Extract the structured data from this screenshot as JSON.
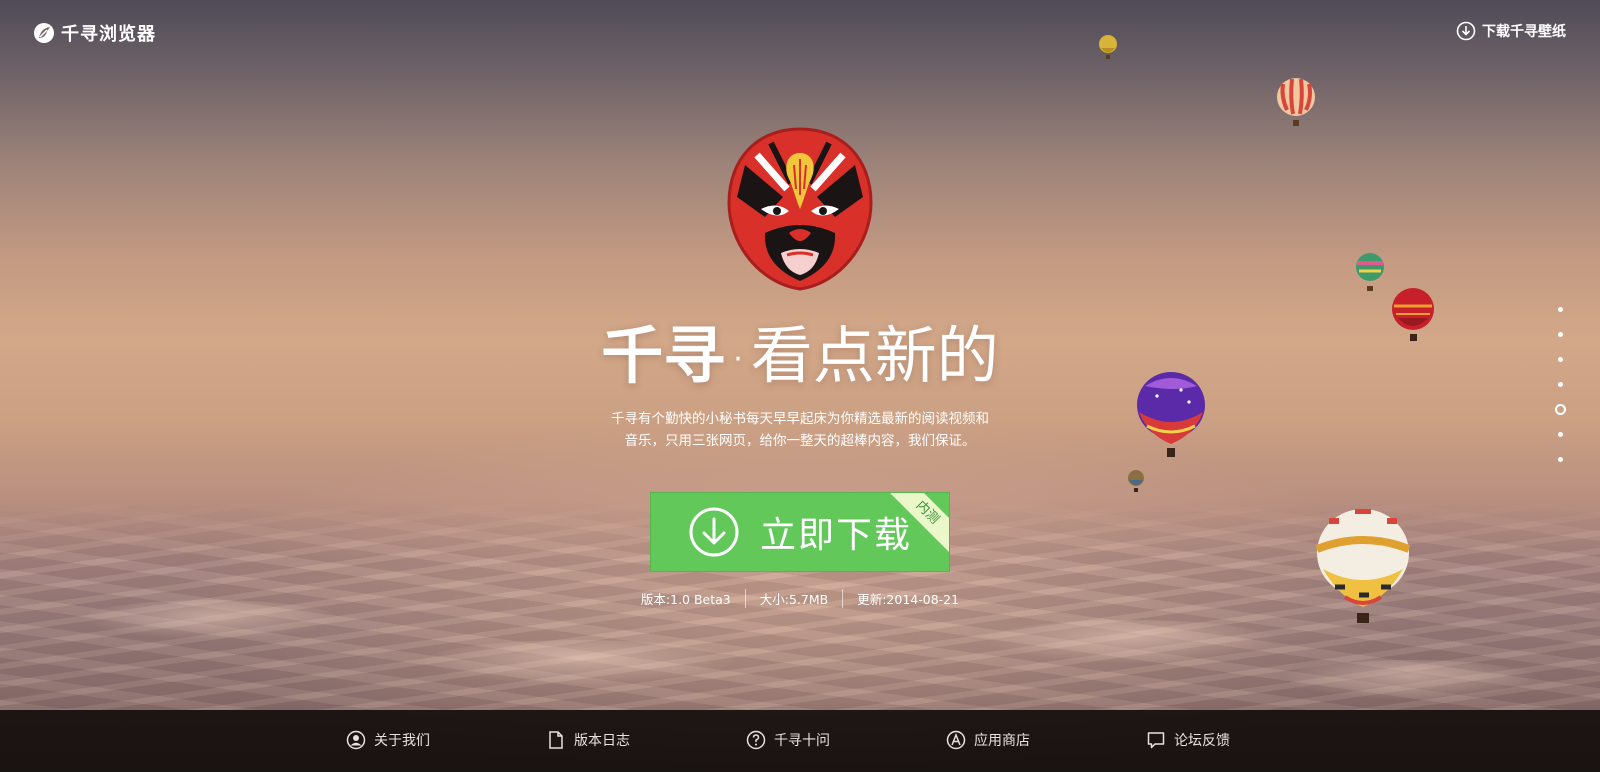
{
  "header": {
    "logo_icon": "leaf-logo-icon",
    "logo_text": "千寻浏览器",
    "wallpaper_link": "下载千寻壁纸",
    "wallpaper_icon": "download-circle-icon"
  },
  "hero": {
    "mascot": "opera-mask-mascot",
    "slogan_brand": "千寻",
    "slogan_dot": "·",
    "slogan_rest": "看点新的",
    "description_line1": "千寻有个勤快的小秘书每天早早起床为你精选最新的阅读视频和",
    "description_line2": "音乐，只用三张网页，给你一整天的超棒内容，我们保证。",
    "download_label": "立即下载",
    "download_icon": "download-circle-icon",
    "badge": "内测",
    "version": "版本:1.0 Beta3",
    "size": "大小:5.7MB",
    "updated": "更新:2014-08-21"
  },
  "side_nav": {
    "count": 7,
    "active_index": 4
  },
  "footer": {
    "items": [
      {
        "label": "关于我们",
        "icon": "user-circle-icon"
      },
      {
        "label": "版本日志",
        "icon": "document-icon"
      },
      {
        "label": "千寻十问",
        "icon": "question-circle-icon"
      },
      {
        "label": "应用商店",
        "icon": "app-store-icon"
      },
      {
        "label": "论坛反馈",
        "icon": "chat-bubble-icon"
      }
    ]
  },
  "colors": {
    "download_green": "#62c85a",
    "badge_bg": "#e9f7c9",
    "footer_bg": "#140e0d"
  }
}
